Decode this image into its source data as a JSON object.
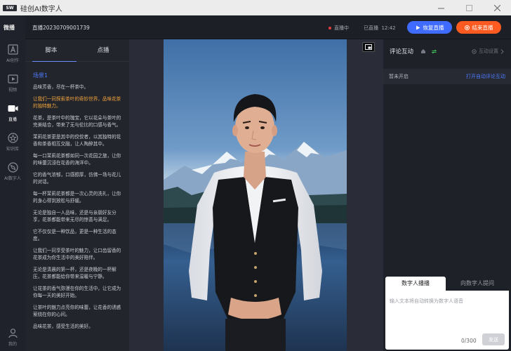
{
  "window": {
    "title": "硅创AI数字人",
    "logo_text": "SW"
  },
  "nav": {
    "brand": "微播",
    "items": [
      {
        "label": "AI创作",
        "icon": "letter-a-icon"
      },
      {
        "label": "视频",
        "icon": "video-play-icon"
      },
      {
        "label": "直播",
        "icon": "camera-icon"
      },
      {
        "label": "知识库",
        "icon": "star-icon"
      },
      {
        "label": "AI数字人",
        "icon": "compass-icon"
      },
      {
        "label": "我的",
        "icon": "user-icon"
      }
    ]
  },
  "topbar": {
    "live_id": "直播20230709001739",
    "status": "直播中",
    "elapsed_label": "已直播",
    "elapsed": "12:42",
    "resume_label": "恢复直播",
    "end_label": "结束直播"
  },
  "script": {
    "tabs": [
      "脚本",
      "点播"
    ],
    "scene_title": "场景1",
    "paragraphs": [
      {
        "text": "品味芳香，尽在一杯茶中。",
        "highlight": false
      },
      {
        "text": "让我们一同探索茶叶的奇妙世界，品味花茶的独特魅力。",
        "highlight": true
      },
      {
        "text": "花茶，是茶叶中的瑰宝，它以花朵与茶叶的完美结合，带来了无与伦比的口感与香气。",
        "highlight": false
      },
      {
        "text": "茉莉花茶更是其中的佼佼者，以其独特的花香和茶香相互交融，让人陶醉其中。",
        "highlight": false
      },
      {
        "text": "每一口茉莉花茶都如同一次花园之旅，让你的味蕾沉浸在花香的海洋中。",
        "highlight": false
      },
      {
        "text": "它的香气浓郁，口感醇厚，仿佛一场与花儿的对话。",
        "highlight": false
      },
      {
        "text": "每一杯茉莉花茶都是一次心灵的洗礼，让你的身心得到放松与舒缓。",
        "highlight": false
      },
      {
        "text": "无论是独自一人品味，还是与亲朋好友分享，花茶都能带来无尽的惊喜与满足。",
        "highlight": false
      },
      {
        "text": "它不仅仅是一种饮品，更是一种生活的态度。",
        "highlight": false
      },
      {
        "text": "让我们一同享受茶叶的魅力，让口齿留香的花茶成为你生活中的美好陪伴。",
        "highlight": false
      },
      {
        "text": "无论是清晨的第一杯，还是夜晚的一杯解压，花茶都能给你带来温暖与宁静。",
        "highlight": false
      },
      {
        "text": "让花茶的香气弥漫在你的生活中，让它成为你每一天的美好开始。",
        "highlight": false
      },
      {
        "text": "让茶叶的魅力点亮你的味蕾，让花香的诱惑萦绕在你的心间。",
        "highlight": false
      },
      {
        "text": "品味花茶，感受生活的美好。",
        "highlight": false
      }
    ]
  },
  "comments": {
    "title": "评论互动",
    "settings_label": "互动设置",
    "status_off": "暂未开启",
    "enable_label": "打开自动评论互动"
  },
  "input": {
    "tabs": [
      "数字人播播",
      "向数字人提问"
    ],
    "placeholder": "输入文本将自动转换为数字人语音",
    "count": "0",
    "max": "/300",
    "send_label": "发送"
  },
  "colors": {
    "accent_blue": "#3f6bff",
    "accent_orange": "#ff5a1f",
    "live_red": "#e23b3b",
    "highlight": "#f0a33a"
  }
}
